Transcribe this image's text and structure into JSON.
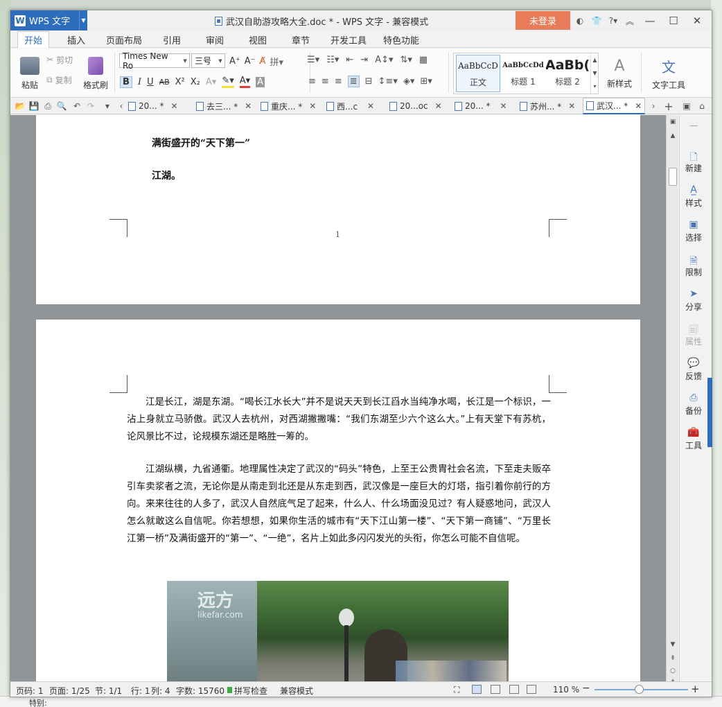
{
  "titlebar": {
    "app_name": "WPS 文字",
    "app_logo": "W",
    "title": "武汉自助游攻略大全.doc * - WPS 文字 - 兼容模式",
    "login": "未登录",
    "icons": [
      "skin-icon",
      "shirt-icon",
      "help-icon",
      "collapse-icon"
    ]
  },
  "menu": {
    "tabs": [
      "开始",
      "插入",
      "页面布局",
      "引用",
      "审阅",
      "视图",
      "章节",
      "开发工具",
      "特色功能"
    ],
    "active": "开始"
  },
  "ribbon": {
    "paste": "粘贴",
    "cut": "剪切",
    "copy": "复制",
    "format_painter": "格式刷",
    "font_name": "Times New Ro",
    "font_size": "三号",
    "bold": "B",
    "italic": "I",
    "underline": "U",
    "strike": "AB",
    "sup": "X²",
    "sub": "X₂",
    "styles": [
      {
        "preview": "AaBbCcD",
        "name": "正文"
      },
      {
        "preview": "AaBbCcDd",
        "name": "标题 1"
      },
      {
        "preview": "AaBb(",
        "name": "标题 2"
      }
    ],
    "new_style": "新样式",
    "text_tools": "文字工具"
  },
  "doctabs": {
    "tabs": [
      {
        "label": "20... *",
        "active": false
      },
      {
        "label": "去三... *",
        "active": false
      },
      {
        "label": "重庆... *",
        "active": false
      },
      {
        "label": "西...c",
        "active": false
      },
      {
        "label": "20...oc",
        "active": false
      },
      {
        "label": "20... *",
        "active": false
      },
      {
        "label": "苏州... *",
        "active": false
      },
      {
        "label": "武汉... *",
        "active": true
      }
    ]
  },
  "document": {
    "page1": {
      "line1": "满街盛开的“天下第一”",
      "line2": "江湖。",
      "page_number": "1"
    },
    "page2": {
      "para1": "江是长江，湖是东湖。“喝长江水长大”并不是说天天到长江舀水当纯净水喝，长江是一个标识，一沾上身就立马骄傲。武汉人去杭州，对西湖撇撇嘴：“我们东湖至少六个这么大。”上有天堂下有苏杭，论风景比不过，论规模东湖还是略胜一筹的。",
      "para2": "江湖纵横，九省通衢。地理属性决定了武汉的“码头”特色，上至王公贵胄社会名流，下至走夫贩卒引车卖浆者之流，无论你是从南走到北还是从东走到西，武汉像是一座巨大的灯塔，指引着你前行的方向。来来往往的人多了，武汉人自然底气足了起来，什么人、什么场面没见过？有人疑惑地问，武汉人怎么就敢这么自信呢。你若想想，如果你生活的城市有“天下江山第一楼”、“天下第一商铺”、“万里长江第一桥”及满街盛开的“第一”、“一绝”，名片上如此多闪闪发光的头衔，你怎么可能不自信呢。",
      "photo_watermark": "远方",
      "photo_watermark_url": "likefar.com"
    }
  },
  "rightpane": {
    "items": [
      {
        "label": "新建",
        "icon": "new-doc-icon"
      },
      {
        "label": "样式",
        "icon": "style-icon"
      },
      {
        "label": "选择",
        "icon": "select-icon"
      },
      {
        "label": "限制",
        "icon": "restrict-icon"
      },
      {
        "label": "分享",
        "icon": "share-icon"
      },
      {
        "label": "属性",
        "icon": "properties-icon"
      },
      {
        "label": "反馈",
        "icon": "feedback-icon"
      },
      {
        "label": "备份",
        "icon": "backup-icon"
      },
      {
        "label": "工具",
        "icon": "toolbox-icon"
      }
    ]
  },
  "status": {
    "page_code": "页码: 1",
    "page": "页面: 1/25",
    "section": "节: 1/1",
    "row": "行: 1",
    "col": "列: 4",
    "words": "字数: 15760",
    "spell": "拼写检查",
    "compat": "兼容模式",
    "zoom": "110 %",
    "zoom_fraction": 0.48
  },
  "desktop": {
    "bottom_label": "特别:"
  }
}
